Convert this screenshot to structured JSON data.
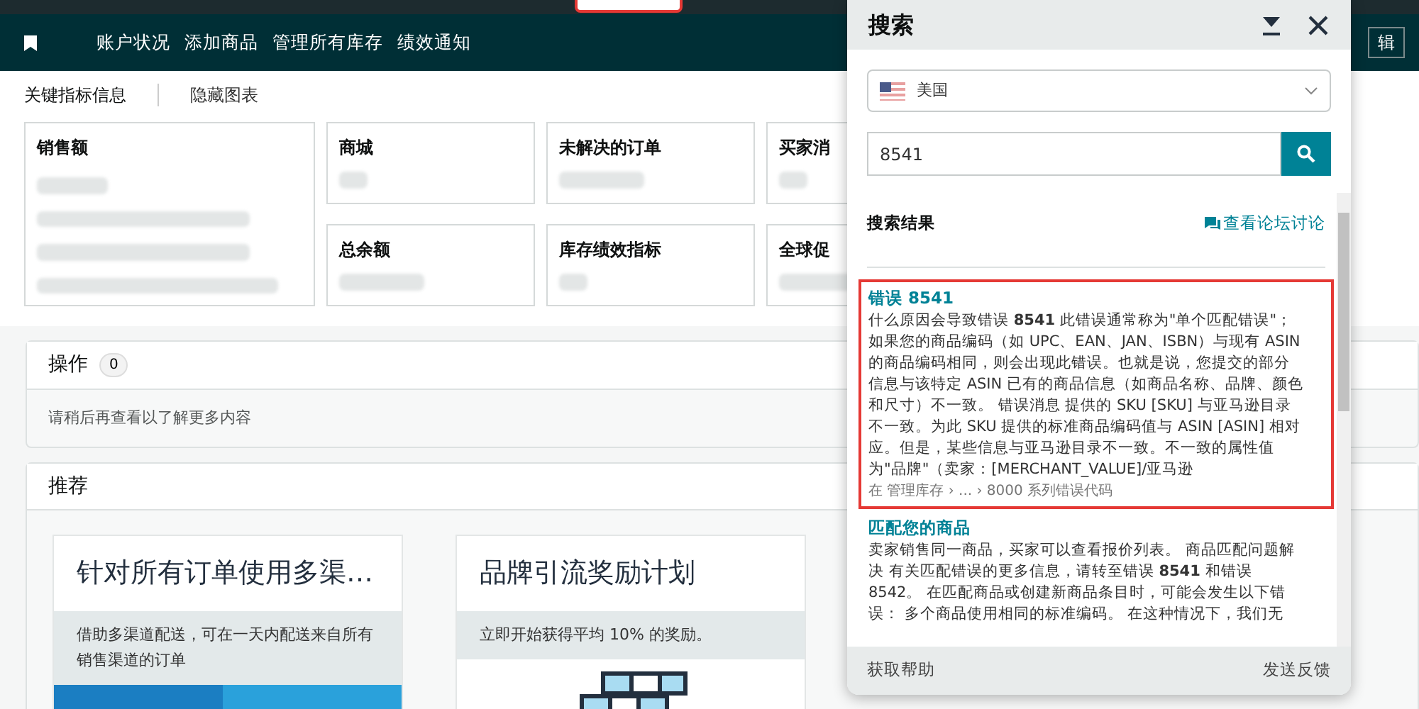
{
  "nav": {
    "items": [
      "账户状况",
      "添加商品",
      "管理所有库存",
      "绩效通知"
    ],
    "edit_button": "辑"
  },
  "metrics": {
    "title": "关键指标信息",
    "toggle": "隐藏图表",
    "cards": [
      {
        "label": "销售额",
        "kind": "large"
      },
      {
        "label": "商城",
        "kind": "small"
      },
      {
        "label": "未解决的订单",
        "kind": "small"
      },
      {
        "label": "买家消",
        "kind": "small"
      },
      {
        "label": "总余额",
        "kind": "small"
      },
      {
        "label": "库存绩效指标",
        "kind": "small"
      },
      {
        "label": "全球促",
        "kind": "small"
      }
    ]
  },
  "actions": {
    "title": "操作",
    "count": "0",
    "message": "请稍后再查看以了解更多内容"
  },
  "recommendations": {
    "title": "推荐",
    "cards": [
      {
        "title": "针对所有订单使用多渠…",
        "description": "借助多渠道配送，可在一天内配送来自所有销售渠道的订单",
        "kind": "picture"
      },
      {
        "title": "品牌引流奖励计划",
        "description": "立即开始获得平均 10% 的奖励。",
        "kind": "illustration"
      }
    ]
  },
  "search_panel": {
    "title": "搜索",
    "marketplace": "美国",
    "query": "8541",
    "results_label": "搜索结果",
    "forum_link": "查看论坛讨论",
    "results": [
      {
        "title": "错误 8541",
        "body": "什么原因会导致错误 **8541** 此错误通常称为\"单个匹配错误\"；如果您的商品编码（如 UPC、EAN、JAN、ISBN）与现有 ASIN 的商品编码相同，则会出现此错误。也就是说，您提交的部分信息与该特定 ASIN 已有的商品信息（如商品名称、品牌、颜色和尺寸）不一致。 错误消息 提供的 SKU [SKU] 与亚马逊目录不一致。为此 SKU 提供的标准商品编码值与 ASIN [ASIN] 相对应。但是，某些信息与亚马逊目录不一致。不一致的属性值为\"品牌\"（卖家：[MERCHANT_VALUE]/亚马逊",
        "path": "在 管理库存 › ... › 8000 系列错误代码",
        "highlighted": true
      },
      {
        "title": "匹配您的商品",
        "body": "卖家销售同一商品，买家可以查看报价列表。 商品匹配问题解决 有关匹配错误的更多信息，请转至错误 **8541** 和错误 8542。 在匹配商品或创建新商品条目时，可能会发生以下错误： 多个商品使用相同的标准编码。 在这种情况下，我们无",
        "highlighted": false
      }
    ],
    "help": "获取帮助",
    "feedback": "发送反馈"
  }
}
